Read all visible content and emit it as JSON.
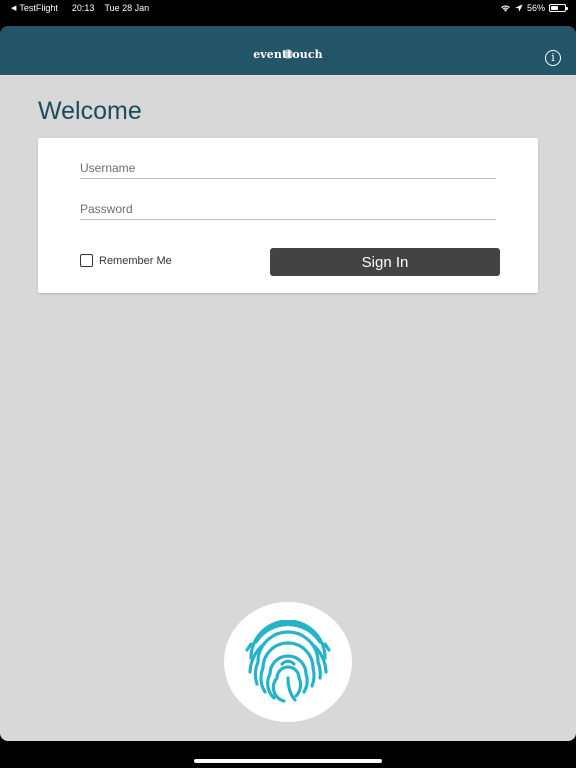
{
  "status_bar": {
    "back_app": "TestFlight",
    "time": "20:13",
    "date": "Tue 28 Jan",
    "battery_percent": "56%",
    "battery_level": 0.56
  },
  "header": {
    "logo_text": "eventtouch",
    "info_icon": "info-icon",
    "background_color": "#235468"
  },
  "login": {
    "title": "Welcome",
    "username_placeholder": "Username",
    "password_placeholder": "Password",
    "remember_label": "Remember Me",
    "remember_checked": false,
    "sign_in_label": "Sign In"
  },
  "biometric": {
    "icon": "fingerprint-icon",
    "icon_color": "#26b3c9"
  }
}
